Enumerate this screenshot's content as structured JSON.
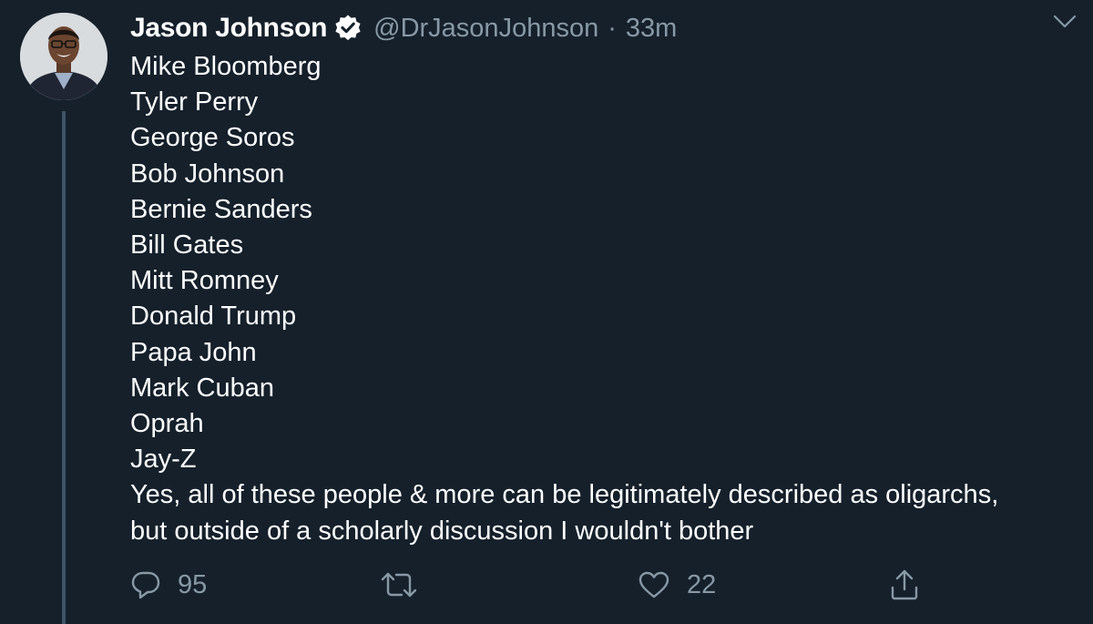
{
  "tweet": {
    "display_name": "Jason Johnson",
    "handle": "@DrJasonJohnson",
    "separator": "·",
    "time": "33m",
    "lines": [
      "Mike Bloomberg",
      "Tyler Perry",
      "George Soros",
      "Bob Johnson",
      "Bernie Sanders",
      "Bill Gates",
      "Mitt Romney",
      "Donald Trump",
      "Papa John",
      "Mark Cuban",
      "Oprah",
      "Jay-Z",
      "Yes, all of these people & more can be legitimately described as oligarchs,",
      "but outside of a scholarly discussion I wouldn't bother"
    ],
    "reply_count": "95",
    "like_count": "22"
  },
  "icons": {
    "verified": "verified-badge-icon",
    "menu": "chevron-down-icon",
    "reply": "speech-bubble-icon",
    "retweet": "retweet-arrows-icon",
    "like": "heart-icon",
    "share": "share-upload-icon"
  },
  "colors": {
    "background": "#15202b",
    "primary_text": "#ffffff",
    "secondary_text": "#8899a6",
    "thread_line": "#3d5466"
  }
}
